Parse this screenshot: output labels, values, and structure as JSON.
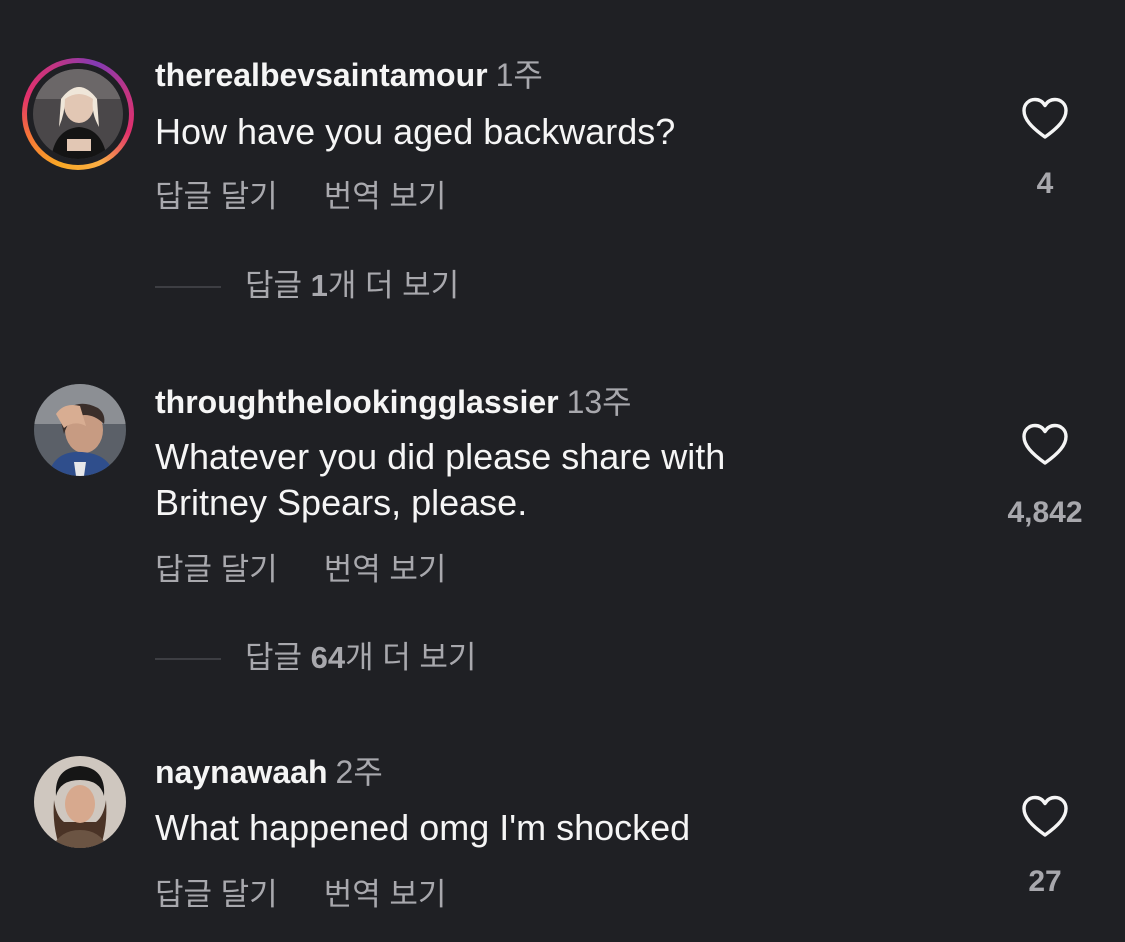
{
  "comments": [
    {
      "username": "therealbevsaintamour",
      "time": "1주",
      "text_lines": [
        "How have you aged backwards?"
      ],
      "actions": {
        "reply": "답글 달기",
        "translate": "번역 보기"
      },
      "likes": "4",
      "replies": {
        "prefix": "답글 ",
        "count": "1",
        "suffix": "개 더 보기"
      },
      "has_story": true
    },
    {
      "username": "throughthelookingglassier",
      "time": "13주",
      "text_lines": [
        "Whatever you did please share with",
        "Britney Spears, please."
      ],
      "actions": {
        "reply": "답글 달기",
        "translate": "번역 보기"
      },
      "likes": "4,842",
      "replies": {
        "prefix": "답글 ",
        "count": "64",
        "suffix": "개 더 보기"
      },
      "has_story": false
    },
    {
      "username": "naynawaah",
      "time": "2주",
      "text_lines": [
        "What happened omg I'm shocked"
      ],
      "actions": {
        "reply": "답글 달기",
        "translate": "번역 보기"
      },
      "likes": "27",
      "has_story": false
    }
  ],
  "icons": {
    "like": "heart-outline-icon"
  },
  "colors": {
    "background": "#1f2024",
    "primary_text": "#f5f5f5",
    "secondary_text": "#a8a8ad",
    "story_ring": [
      "#f9a825",
      "#e1306c",
      "#833ab4"
    ]
  }
}
